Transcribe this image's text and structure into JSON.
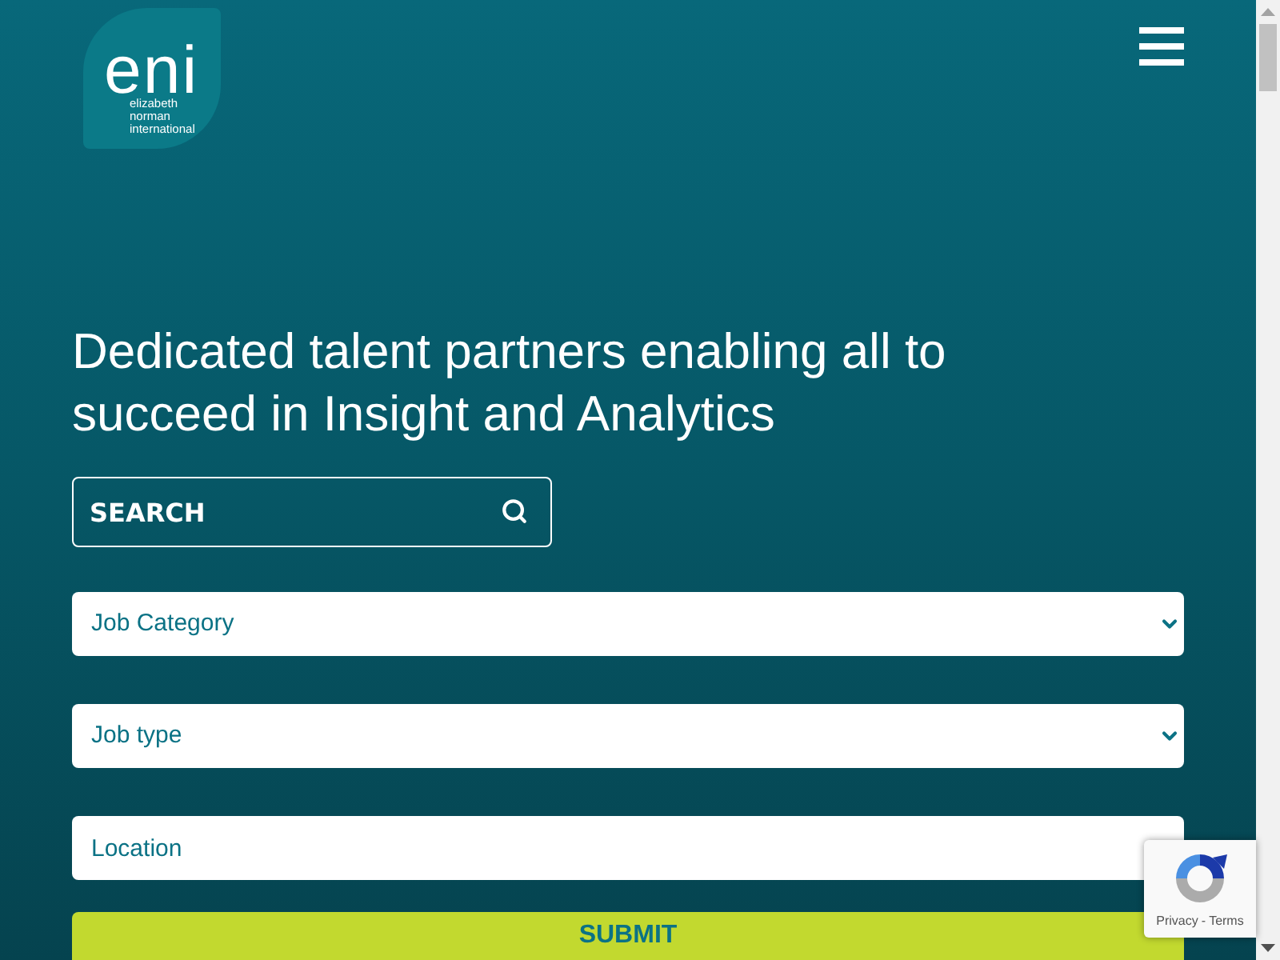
{
  "logo": {
    "mark": "eni",
    "name_lines": [
      "elizabeth",
      "norman",
      "international"
    ]
  },
  "hero": {
    "headline": "Dedicated talent partners enabling all to succeed in Insight and Analytics"
  },
  "search": {
    "placeholder": "SEARCH"
  },
  "filters": [
    {
      "kind": "select",
      "placeholder": "Job Category"
    },
    {
      "kind": "select",
      "placeholder": "Job type"
    },
    {
      "kind": "text",
      "placeholder": "Location"
    }
  ],
  "submit_button": {
    "label": "SUBMIT"
  },
  "recaptcha": {
    "links": [
      "Privacy",
      "Terms"
    ],
    "separator": "-"
  }
}
